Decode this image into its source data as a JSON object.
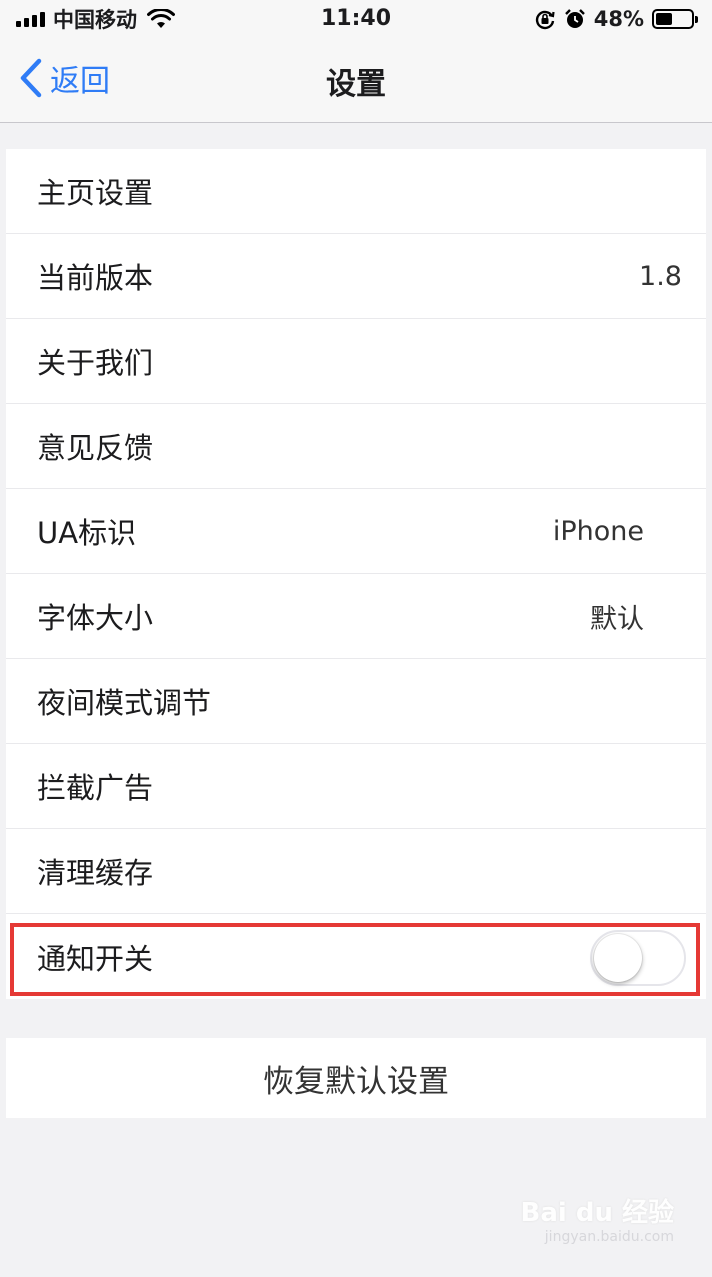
{
  "status_bar": {
    "carrier": "中国移动",
    "time": "11:40",
    "battery_percent": "48%",
    "battery_level": 0.48,
    "icons": [
      "signal-icon",
      "wifi-icon",
      "orientation-lock-icon",
      "alarm-icon",
      "battery-icon"
    ]
  },
  "nav": {
    "back_label": "返回",
    "title": "设置"
  },
  "rows": [
    {
      "label": "主页设置",
      "value": ""
    },
    {
      "label": "当前版本",
      "value": "1.8"
    },
    {
      "label": "关于我们",
      "value": ""
    },
    {
      "label": "意见反馈",
      "value": ""
    },
    {
      "label": "UA标识",
      "value": "iPhone"
    },
    {
      "label": "字体大小",
      "value": "默认"
    },
    {
      "label": "夜间模式调节",
      "value": ""
    },
    {
      "label": "拦截广告",
      "value": ""
    },
    {
      "label": "清理缓存",
      "value": ""
    },
    {
      "label": "通知开关",
      "toggle_on": false
    }
  ],
  "reset_label": "恢复默认设置",
  "watermark": {
    "main": "Bai du 经验",
    "sub": "jingyan.baidu.com"
  },
  "colors": {
    "accent": "#2f7cf6",
    "highlight": "#e53935",
    "background": "#f2f2f4"
  }
}
